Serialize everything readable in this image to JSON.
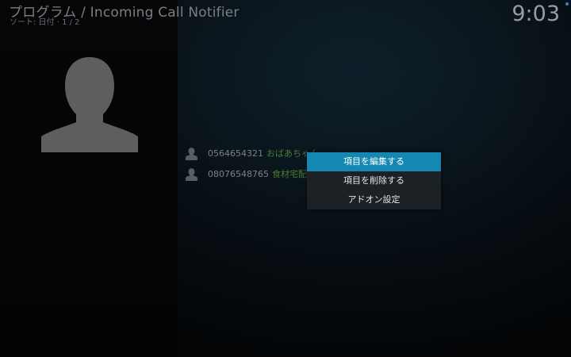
{
  "header": {
    "title": "プログラム / Incoming Call Notifier",
    "subtitle": "ソート: 日付 · 1 / 2",
    "clock": "9:03"
  },
  "detail": {
    "avatar_icon": "person-silhouette-icon"
  },
  "call_list": [
    {
      "number": "0564654321",
      "label": "おばあちゃん",
      "icon": "person-icon"
    },
    {
      "number": "08076548765",
      "label": "食材宅配",
      "icon": "person-icon"
    }
  ],
  "context_menu": {
    "items": [
      {
        "label": "項目を編集する",
        "focused": true
      },
      {
        "label": "項目を削除する",
        "focused": false
      },
      {
        "label": "アドオン設定",
        "focused": false
      }
    ]
  },
  "colors": {
    "accent": "#1488b3",
    "label_green": "#4b7b35",
    "menu_bg": "#1b2124"
  }
}
